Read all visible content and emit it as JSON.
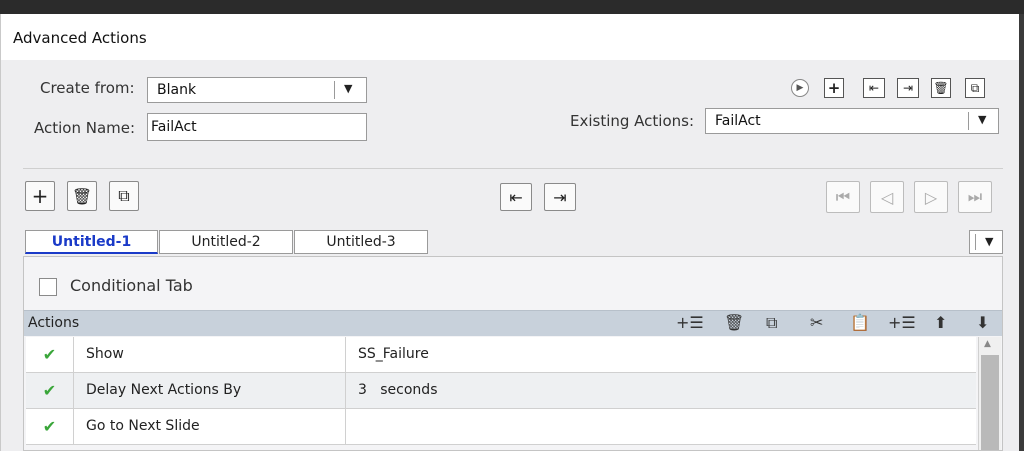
{
  "window": {
    "title": "Advanced Actions"
  },
  "form": {
    "create_from_label": "Create from:",
    "create_from_value": "Blank",
    "action_name_label": "Action Name:",
    "action_name_value": "FailAct",
    "existing_actions_label": "Existing Actions:",
    "existing_actions_value": "FailAct"
  },
  "tabs": [
    "Untitled-1",
    "Untitled-2",
    "Untitled-3"
  ],
  "conditional_tab_label": "Conditional Tab",
  "actions": {
    "header": "Actions",
    "rows": [
      {
        "status": "check",
        "action": "Show",
        "target": "SS_Failure"
      },
      {
        "status": "check",
        "action": "Delay Next Actions By",
        "target": "3   seconds"
      },
      {
        "status": "check",
        "action": "Go to Next Slide",
        "target": ""
      }
    ]
  },
  "icons": {
    "check_glyph": "✔",
    "accent_tab_color": "#1a3ac8",
    "check_color": "#3aa63a"
  }
}
